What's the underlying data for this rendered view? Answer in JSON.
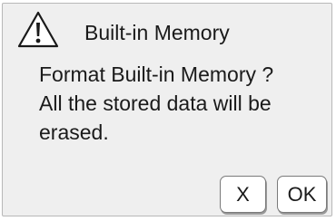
{
  "dialog": {
    "title": "Built-in Memory",
    "icon": "warning-icon",
    "message_lines": [
      "Format Built-in Memory ?",
      "All the stored data will be",
      "erased."
    ]
  },
  "buttons": {
    "cancel_label": "X",
    "ok_label": "OK"
  },
  "colors": {
    "dialog_background": "#efefef",
    "button_background": "#ffffff",
    "text": "#1a1a1a"
  }
}
